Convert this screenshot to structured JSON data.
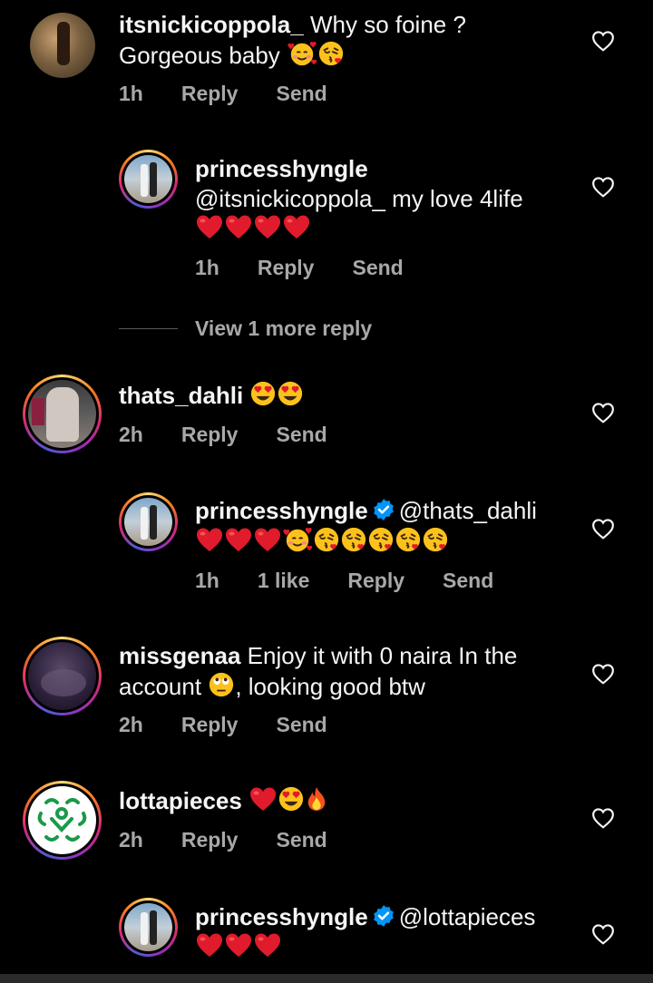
{
  "comments": [
    {
      "username": "itsnickicoppola_",
      "line1": "Why so foine ?",
      "line2": "Gorgeous baby",
      "time": "1h",
      "reply": "Reply",
      "send": "Send"
    },
    {
      "username": "princesshyngle",
      "line1": "@itsnickicoppola_ my love 4life",
      "time": "1h",
      "reply": "Reply",
      "send": "Send"
    },
    {
      "username": "thats_dahli",
      "time": "2h",
      "reply": "Reply",
      "send": "Send"
    },
    {
      "username": "princesshyngle",
      "mention": "@thats_dahli",
      "time": "1h",
      "likes": "1 like",
      "reply": "Reply",
      "send": "Send"
    },
    {
      "username": "missgenaa",
      "line1": "Enjoy it with 0 naira In the",
      "line2a": "account",
      "line2b": ", looking good btw",
      "time": "2h",
      "reply": "Reply",
      "send": "Send"
    },
    {
      "username": "lottapieces",
      "time": "2h",
      "reply": "Reply",
      "send": "Send"
    },
    {
      "username": "princesshyngle",
      "mention": "@lottapieces"
    }
  ],
  "view_more": "View 1 more reply",
  "icons": {
    "like": "heart-outline-icon",
    "verified": "verified-badge-icon",
    "emoji_heart": "red-heart-emoji",
    "emoji_smiling_hearts": "smiling-face-with-hearts-emoji",
    "emoji_kiss": "face-blowing-kiss-emoji",
    "emoji_heart_eyes": "heart-eyes-emoji",
    "emoji_eye_roll": "face-with-rolling-eyes-emoji",
    "emoji_fire": "fire-emoji"
  },
  "colors": {
    "background": "#000000",
    "text": "#f5f5f5",
    "meta": "#a8a8a8",
    "verified": "#0095f6"
  }
}
